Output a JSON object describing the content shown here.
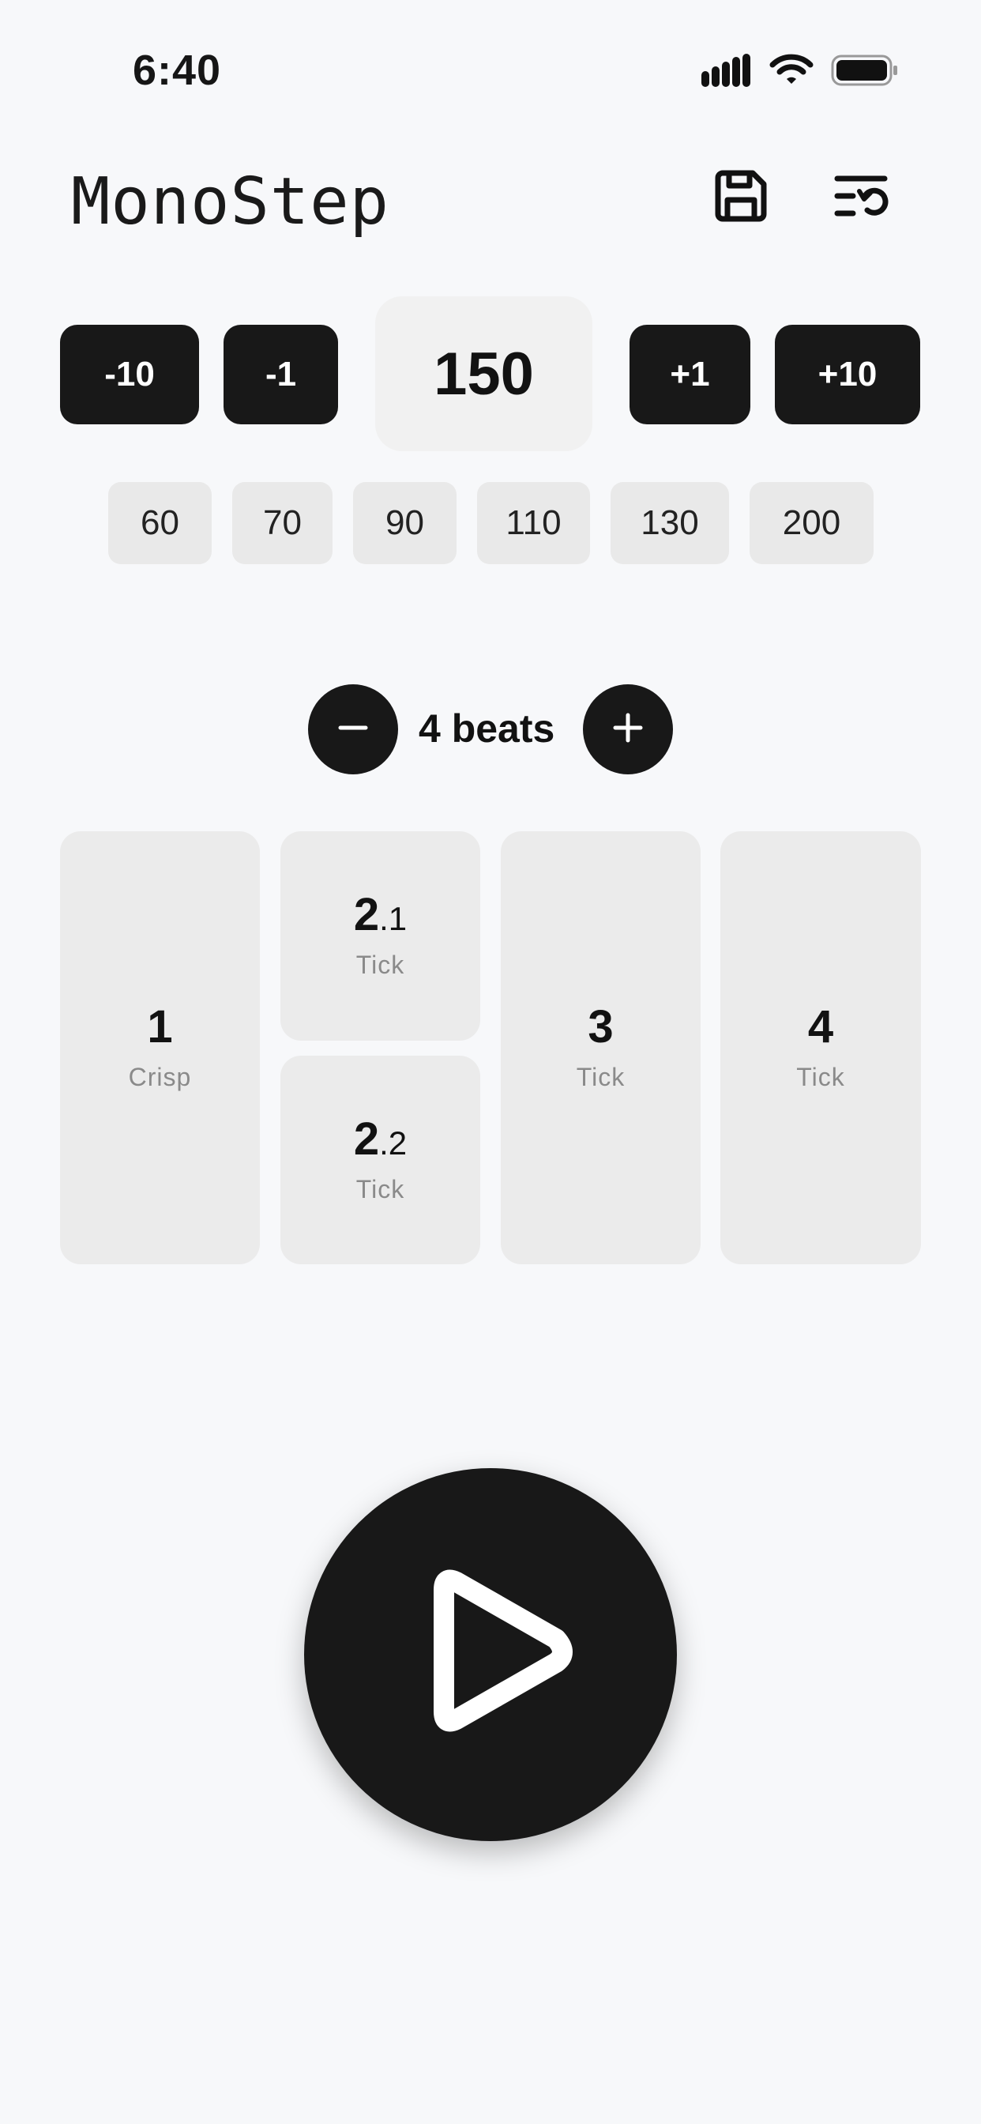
{
  "status_bar": {
    "time": "6:40",
    "icons": [
      "signal-icon",
      "wifi-icon",
      "battery-icon"
    ]
  },
  "header": {
    "title": "MonoStep",
    "icons": [
      "save-icon",
      "history-icon"
    ]
  },
  "tempo": {
    "decrement_10": "-10",
    "decrement_1": "-1",
    "bpm": "150",
    "increment_1": "+1",
    "increment_10": "+10",
    "presets": [
      "60",
      "70",
      "90",
      "110",
      "130",
      "200"
    ]
  },
  "beats": {
    "label": "4 beats",
    "items": [
      {
        "number": "1",
        "sound": "Crisp"
      },
      {
        "number": "2",
        "sub": ".1",
        "sound": "Tick"
      },
      {
        "number": "2",
        "sub": ".2",
        "sound": "Tick"
      },
      {
        "number": "3",
        "sound": "Tick"
      },
      {
        "number": "4",
        "sound": "Tick"
      }
    ]
  },
  "colors": {
    "background": "#f7f8fa",
    "dark": "#181818",
    "tile": "#ebebeb",
    "muted_text": "#8a8a8a"
  },
  "play": {
    "icon": "play-icon"
  }
}
